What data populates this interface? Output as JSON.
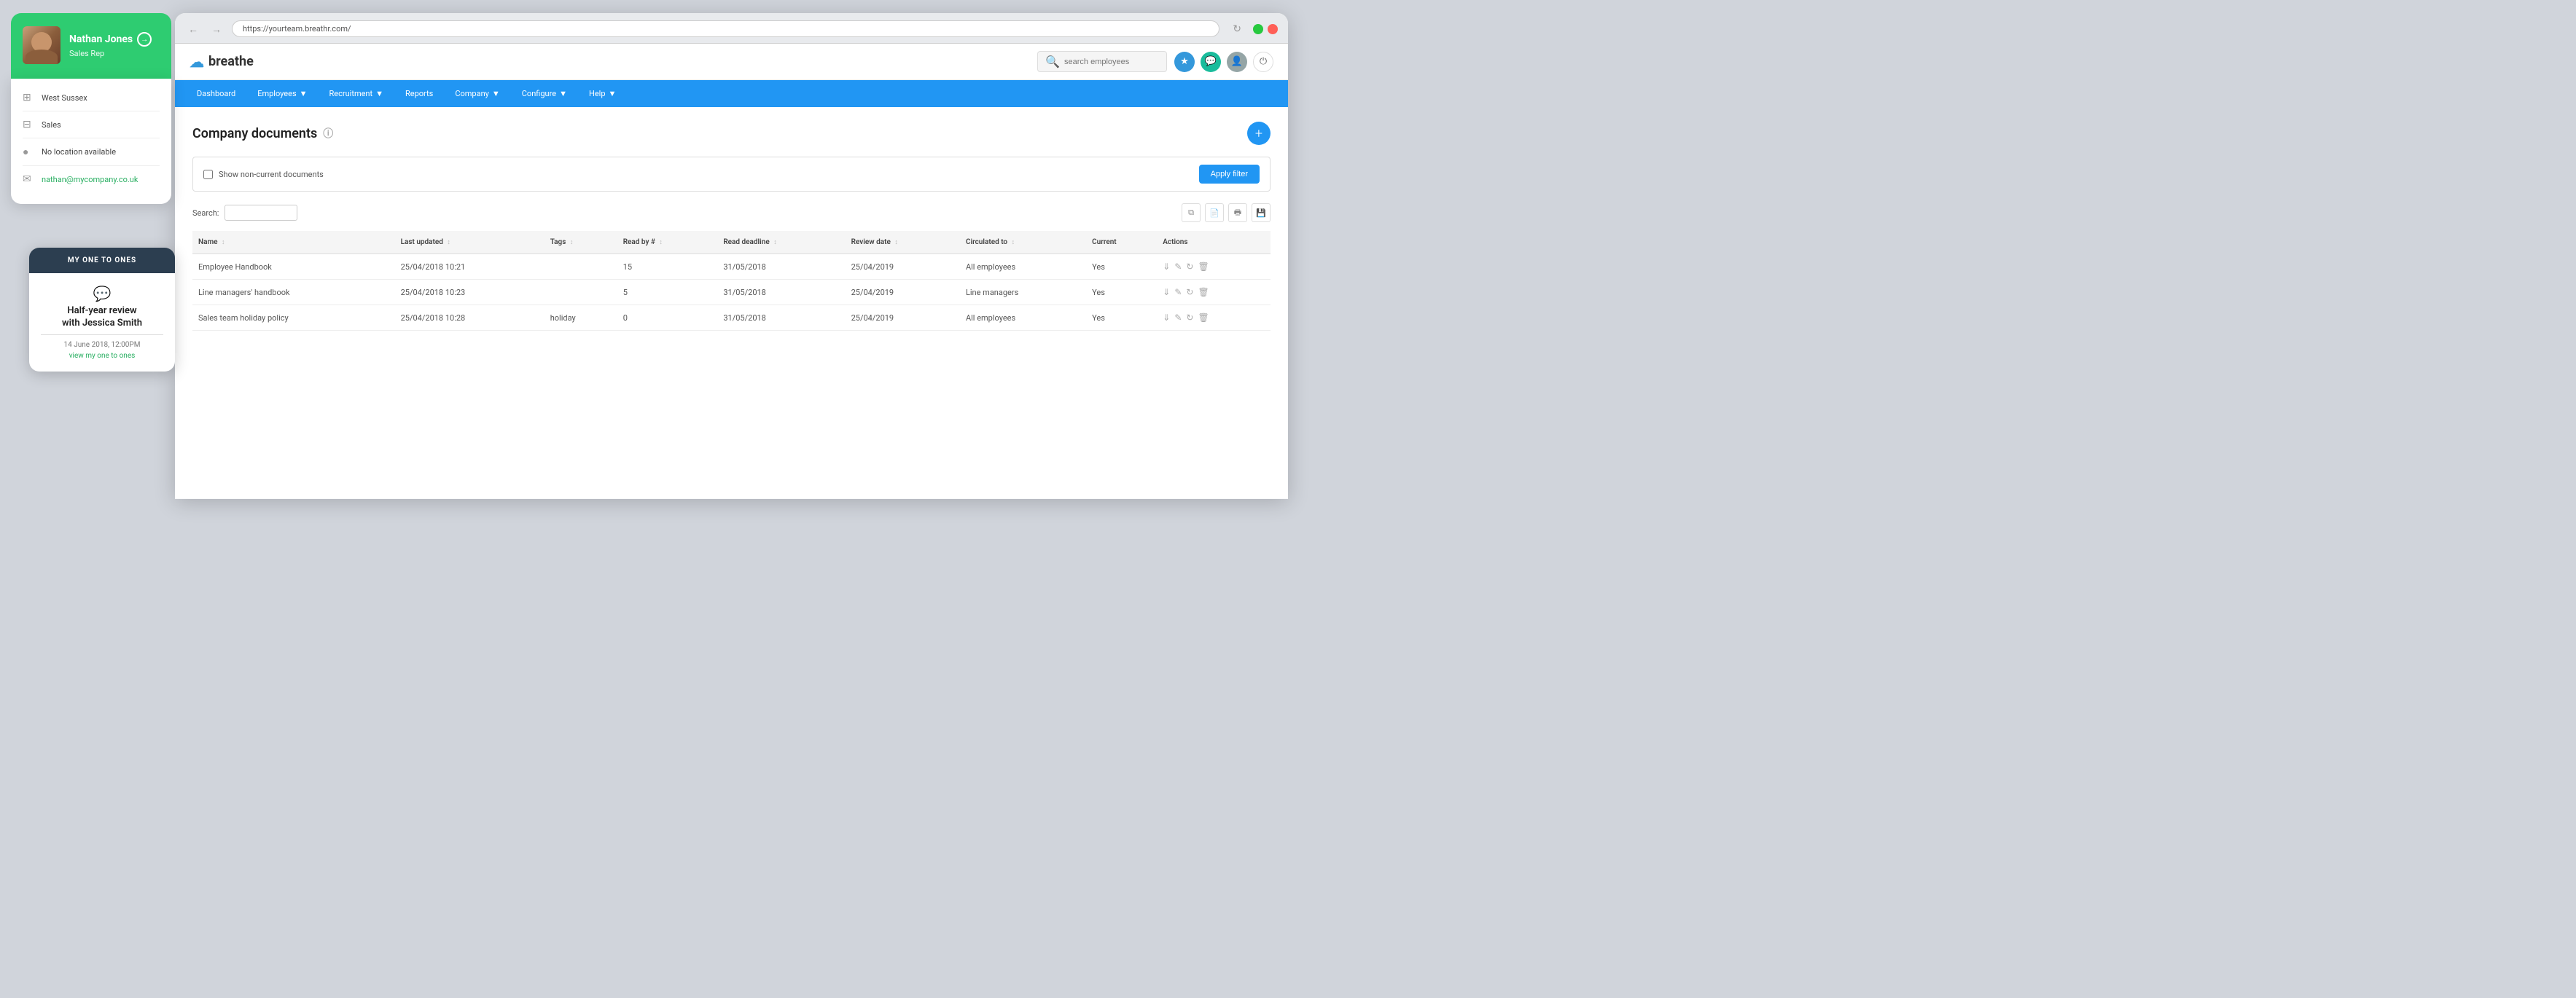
{
  "profile": {
    "name": "Nathan Jones",
    "role": "Sales Rep",
    "department": "West Sussex",
    "team": "Sales",
    "location": "No location available",
    "email": "nathan@mycompany.co.uk"
  },
  "one_to_ones": {
    "header": "MY ONE TO ONES",
    "review_title": "Half-year review",
    "review_with": "with Jessica Smith",
    "review_date": "14 June 2018, 12:00PM",
    "view_link": "view my one to ones"
  },
  "browser": {
    "url": "https://yourteam.breathr.com/"
  },
  "app": {
    "logo": "breathe",
    "search_placeholder": "search employees"
  },
  "nav": {
    "items": [
      {
        "label": "Dashboard",
        "has_dropdown": false
      },
      {
        "label": "Employees",
        "has_dropdown": true
      },
      {
        "label": "Recruitment",
        "has_dropdown": true
      },
      {
        "label": "Reports",
        "has_dropdown": false
      },
      {
        "label": "Company",
        "has_dropdown": true
      },
      {
        "label": "Configure",
        "has_dropdown": true
      },
      {
        "label": "Help",
        "has_dropdown": true
      }
    ]
  },
  "page": {
    "title": "Company documents",
    "filter_label": "Show non-current documents",
    "apply_filter": "Apply filter",
    "search_label": "Search:"
  },
  "table": {
    "columns": [
      {
        "label": "Name",
        "sortable": true
      },
      {
        "label": "Last updated",
        "sortable": true
      },
      {
        "label": "Tags",
        "sortable": true
      },
      {
        "label": "Read by #",
        "sortable": true
      },
      {
        "label": "Read deadline",
        "sortable": true
      },
      {
        "label": "Review date",
        "sortable": true
      },
      {
        "label": "Circulated to",
        "sortable": true
      },
      {
        "label": "Current",
        "sortable": false
      },
      {
        "label": "Actions",
        "sortable": false
      }
    ],
    "rows": [
      {
        "name": "Employee Handbook",
        "last_updated": "25/04/2018 10:21",
        "tags": "",
        "read_by": "15",
        "read_deadline": "31/05/2018",
        "review_date": "25/04/2019",
        "circulated_to": "All employees",
        "current": "Yes"
      },
      {
        "name": "Line managers' handbook",
        "last_updated": "25/04/2018 10:23",
        "tags": "",
        "read_by": "5",
        "read_deadline": "31/05/2018",
        "review_date": "25/04/2019",
        "circulated_to": "Line managers",
        "current": "Yes"
      },
      {
        "name": "Sales team holiday policy",
        "last_updated": "25/04/2018 10:28",
        "tags": "holiday",
        "read_by": "0",
        "read_deadline": "31/05/2018",
        "review_date": "25/04/2019",
        "circulated_to": "All employees",
        "current": "Yes"
      }
    ]
  }
}
